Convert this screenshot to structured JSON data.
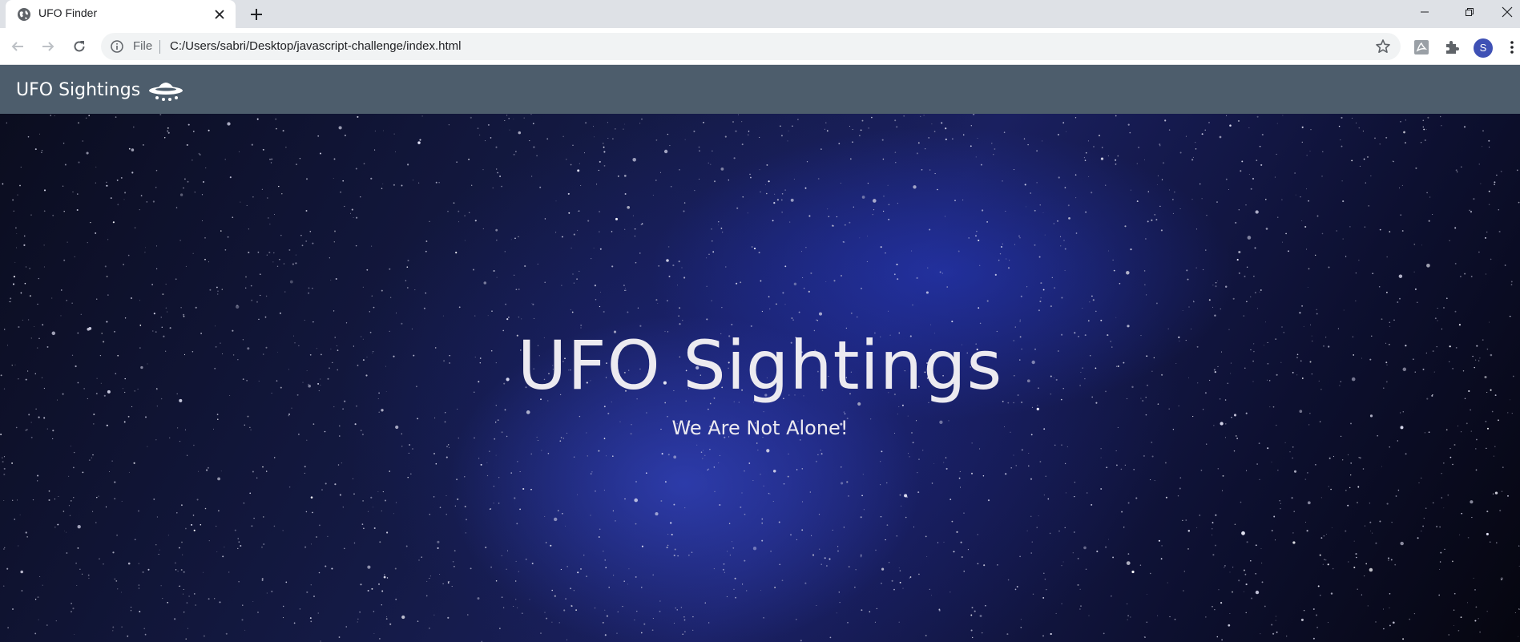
{
  "browser": {
    "tab": {
      "title": "UFO Finder"
    },
    "address_bar": {
      "scheme_label": "File",
      "url": "C:/Users/sabri/Desktop/javascript-challenge/index.html"
    },
    "profile_initial": "S"
  },
  "page": {
    "navbar": {
      "brand": "UFO Sightings",
      "brand_icon": "ufo-icon"
    },
    "hero": {
      "title": "UFO Sightings",
      "subtitle": "We Are Not Alone!"
    }
  },
  "colors": {
    "navbar": "#4d5d6c",
    "hero_text": "#eceaf0",
    "avatar": "#3f51b5"
  }
}
